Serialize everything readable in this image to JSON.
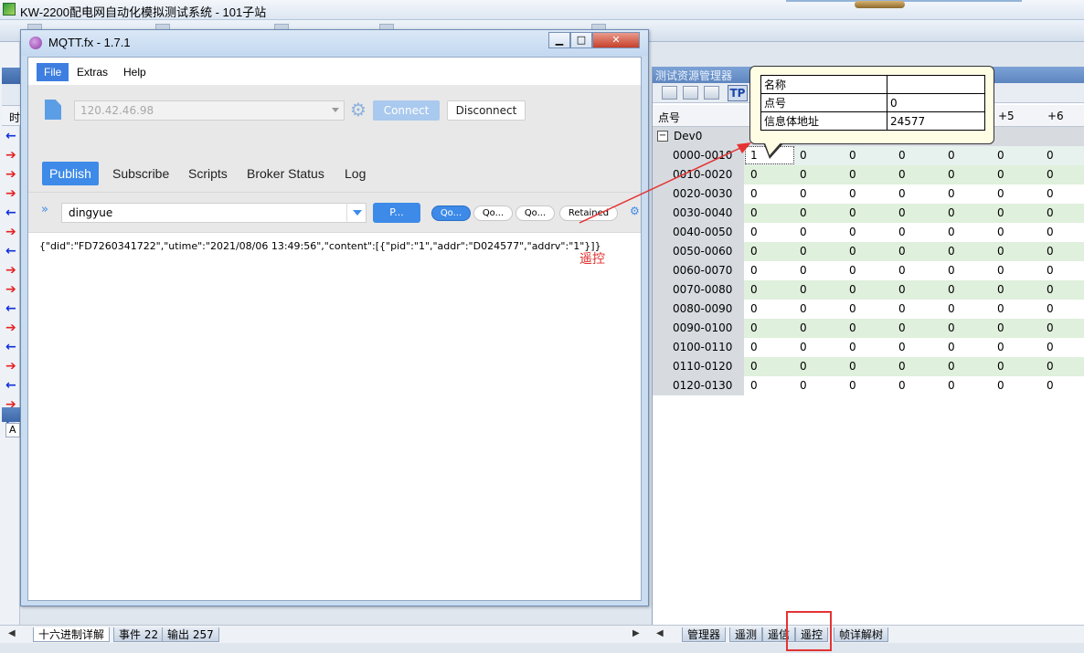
{
  "app": {
    "title": "KW-2200配电网自动化模拟测试系统 - 101子站"
  },
  "left_panel": {
    "col_header": "时",
    "arrows": [
      "left",
      "right",
      "right",
      "right",
      "left",
      "right",
      "left",
      "right",
      "right",
      "left",
      "right",
      "left",
      "right",
      "left",
      "right",
      "left"
    ],
    "lower_cell": "A"
  },
  "bottom_tabs_left": [
    {
      "label": "十六进制详解",
      "active": true
    },
    {
      "label": "事件 22",
      "active": false
    },
    {
      "label": "输出 257",
      "active": false
    }
  ],
  "bottom_tabs_right": [
    {
      "label": "管理器"
    },
    {
      "label": "遥测"
    },
    {
      "label": "遥信"
    },
    {
      "label": "遥控"
    },
    {
      "label": "帧详解树"
    }
  ],
  "mqtt": {
    "title": "MQTT.fx - 1.7.1",
    "menu": [
      "File",
      "Extras",
      "Help"
    ],
    "broker": "120.42.46.98",
    "connect_label": "Connect",
    "disconnect_label": "Disconnect",
    "tabs": [
      "Publish",
      "Subscribe",
      "Scripts",
      "Broker Status",
      "Log"
    ],
    "topic": "dingyue",
    "publish_btn": "P...",
    "qos_pills": [
      "Qo...",
      "Qo...",
      "Qo..."
    ],
    "retained": "Retained",
    "payload": "{\"did\":\"FD7260341722\",\"utime\":\"2021/08/06 13:49:56\",\"content\":[{\"pid\":\"1\",\"addr\":\"D024577\",\"addrv\":\"1\"}]}"
  },
  "annotation": {
    "label": "遥控",
    "color": "#e03030"
  },
  "resource_manager": {
    "title": "测试资源管理器",
    "tp_label": "TP",
    "header": {
      "name_col": "点号",
      "plus5": "+5",
      "plus6": "+6"
    },
    "group": "Dev0",
    "rows": [
      {
        "label": "0000-0010",
        "values": [
          "1",
          "0",
          "0",
          "0",
          "0",
          "0",
          "0"
        ]
      },
      {
        "label": "0010-0020",
        "values": [
          "0",
          "0",
          "0",
          "0",
          "0",
          "0",
          "0"
        ]
      },
      {
        "label": "0020-0030",
        "values": [
          "0",
          "0",
          "0",
          "0",
          "0",
          "0",
          "0"
        ]
      },
      {
        "label": "0030-0040",
        "values": [
          "0",
          "0",
          "0",
          "0",
          "0",
          "0",
          "0"
        ]
      },
      {
        "label": "0040-0050",
        "values": [
          "0",
          "0",
          "0",
          "0",
          "0",
          "0",
          "0"
        ]
      },
      {
        "label": "0050-0060",
        "values": [
          "0",
          "0",
          "0",
          "0",
          "0",
          "0",
          "0"
        ]
      },
      {
        "label": "0060-0070",
        "values": [
          "0",
          "0",
          "0",
          "0",
          "0",
          "0",
          "0"
        ]
      },
      {
        "label": "0070-0080",
        "values": [
          "0",
          "0",
          "0",
          "0",
          "0",
          "0",
          "0"
        ]
      },
      {
        "label": "0080-0090",
        "values": [
          "0",
          "0",
          "0",
          "0",
          "0",
          "0",
          "0"
        ]
      },
      {
        "label": "0090-0100",
        "values": [
          "0",
          "0",
          "0",
          "0",
          "0",
          "0",
          "0"
        ]
      },
      {
        "label": "0100-0110",
        "values": [
          "0",
          "0",
          "0",
          "0",
          "0",
          "0",
          "0"
        ]
      },
      {
        "label": "0110-0120",
        "values": [
          "0",
          "0",
          "0",
          "0",
          "0",
          "0",
          "0"
        ]
      },
      {
        "label": "0120-0130",
        "values": [
          "0",
          "0",
          "0",
          "0",
          "0",
          "0",
          "0"
        ]
      }
    ],
    "tooltip": [
      {
        "key": "名称",
        "value": ""
      },
      {
        "key": "点号",
        "value": "0"
      },
      {
        "key": "信息体地址",
        "value": "24577"
      }
    ]
  }
}
